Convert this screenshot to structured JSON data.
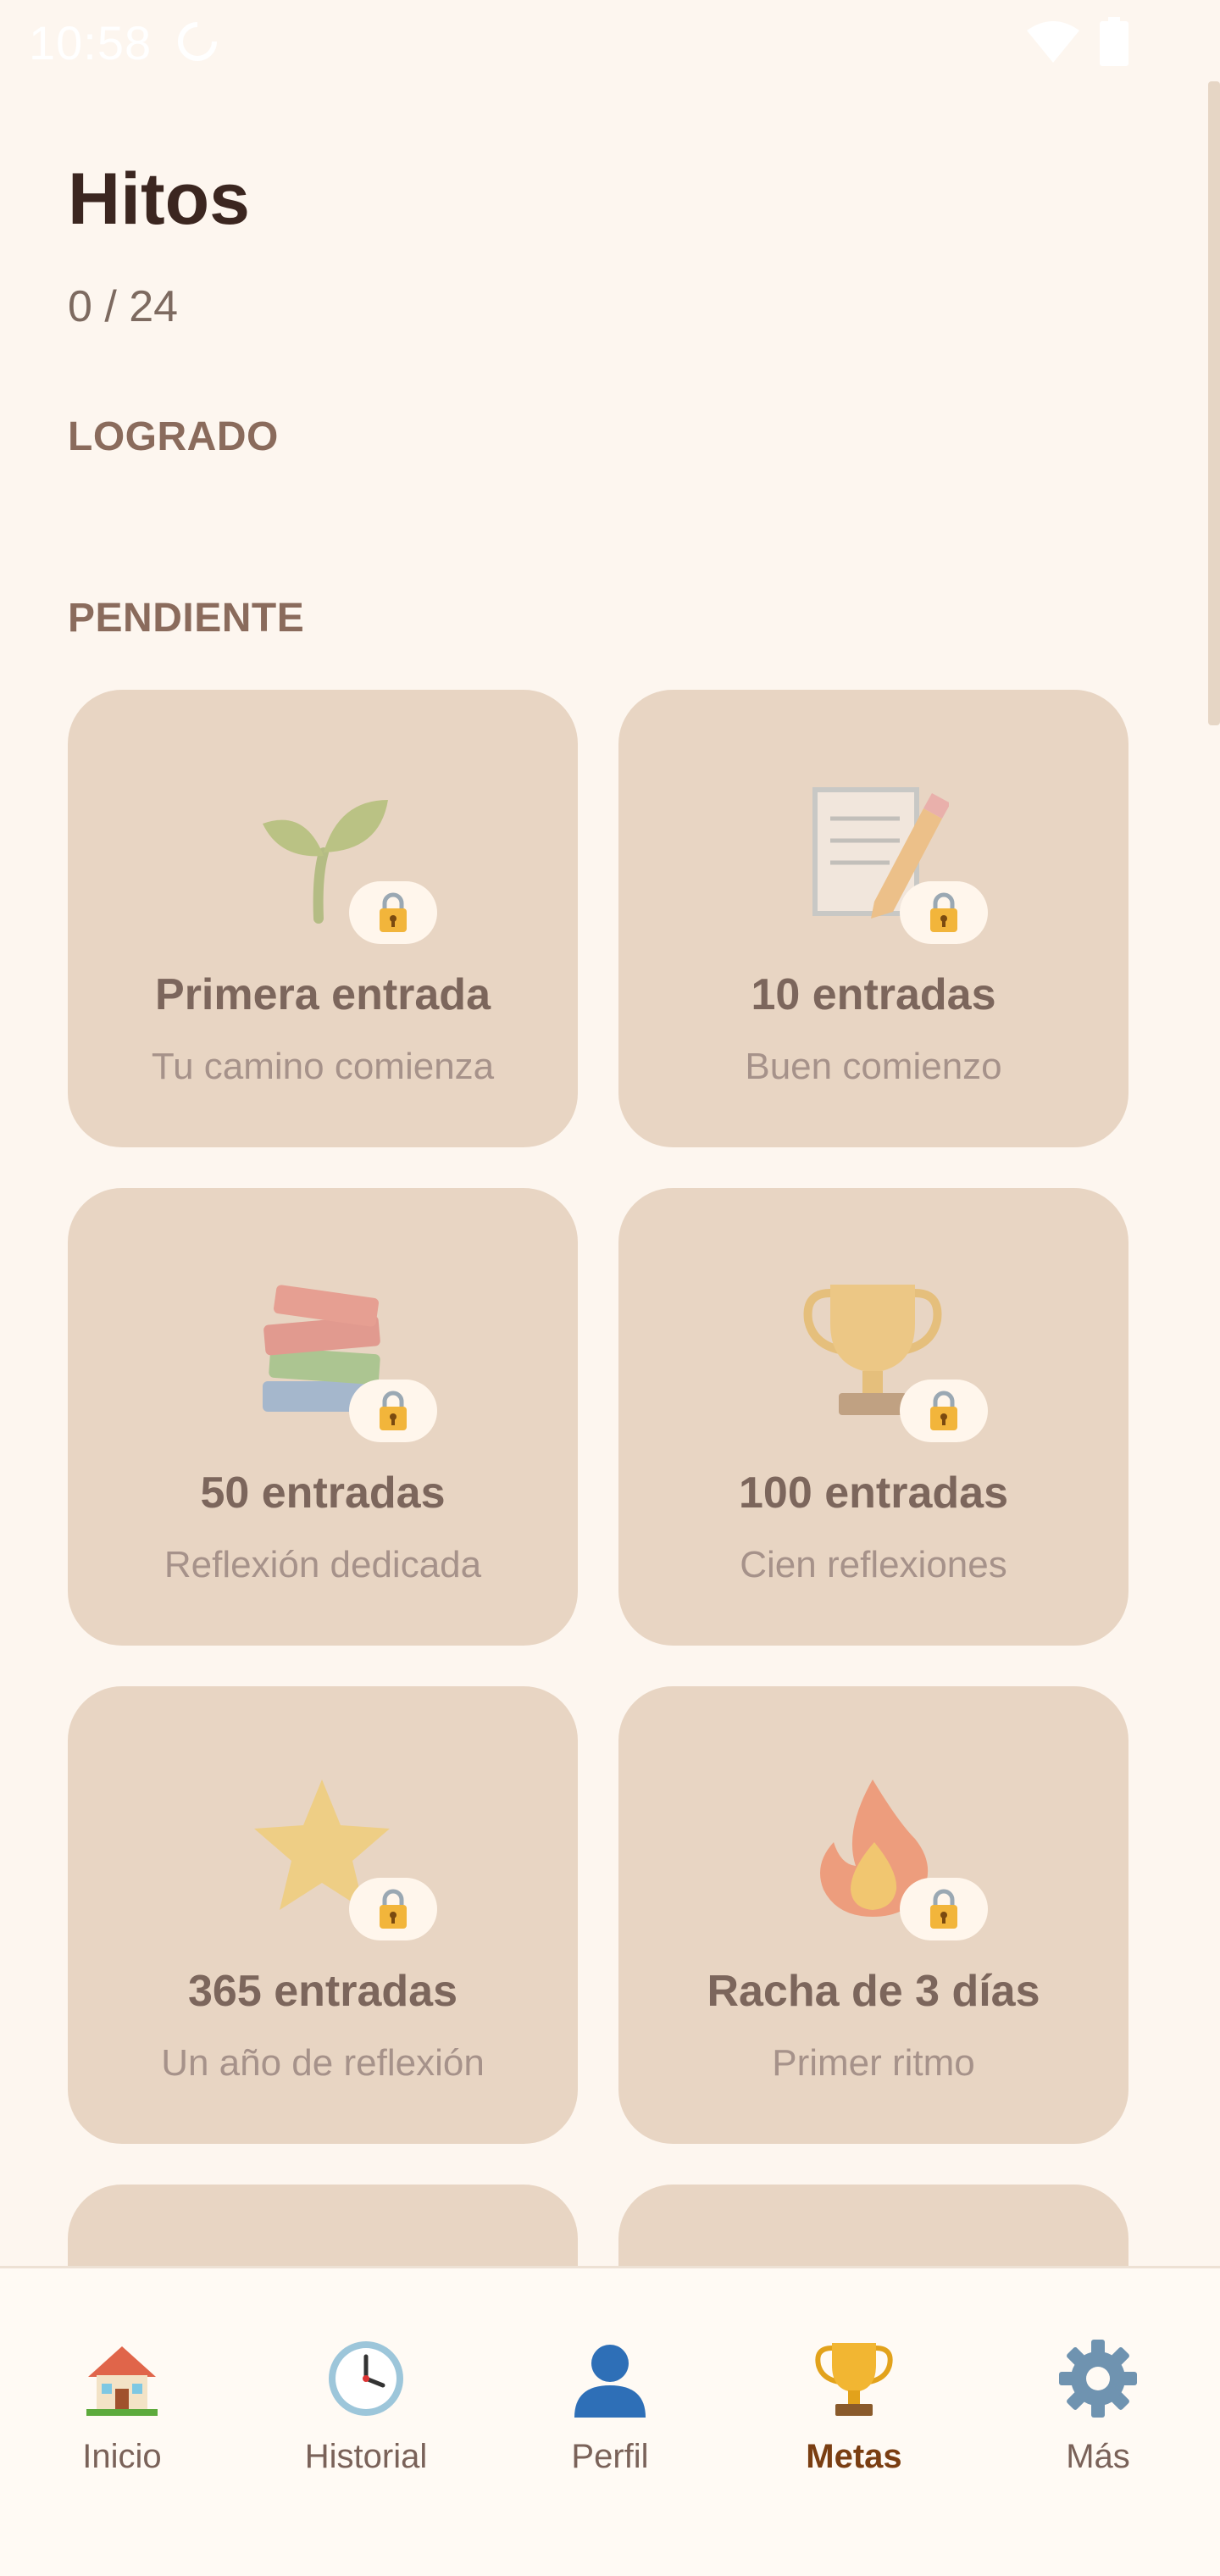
{
  "status_bar": {
    "time": "10:58"
  },
  "header": {
    "title": "Hitos",
    "progress": "0 / 24"
  },
  "sections": {
    "achieved_label": "LOGRADO",
    "pending_label": "PENDIENTE"
  },
  "milestones": [
    {
      "icon": "seedling-icon",
      "title": "Primera entrada",
      "subtitle": "Tu camino comienza",
      "locked": true
    },
    {
      "icon": "memo-icon",
      "title": "10 entradas",
      "subtitle": "Buen comienzo",
      "locked": true
    },
    {
      "icon": "books-icon",
      "title": "50 entradas",
      "subtitle": "Reflexión dedicada",
      "locked": true
    },
    {
      "icon": "trophy-icon",
      "title": "100 entradas",
      "subtitle": "Cien reflexiones",
      "locked": true
    },
    {
      "icon": "star-icon",
      "title": "365 entradas",
      "subtitle": "Un año de reflexión",
      "locked": true
    },
    {
      "icon": "fire-icon",
      "title": "Racha de 3 días",
      "subtitle": "Primer ritmo",
      "locked": true
    }
  ],
  "nav": {
    "items": [
      {
        "label": "Inicio",
        "icon": "house-icon"
      },
      {
        "label": "Historial",
        "icon": "clock-icon"
      },
      {
        "label": "Perfil",
        "icon": "person-icon"
      },
      {
        "label": "Metas",
        "icon": "trophy-icon"
      },
      {
        "label": "Más",
        "icon": "gear-icon"
      }
    ],
    "active_index": 3
  },
  "colors": {
    "background": "#FDF6EF",
    "card": "#E8D5C3",
    "title_text": "#3B2620",
    "active_nav": "#7A3E12"
  }
}
